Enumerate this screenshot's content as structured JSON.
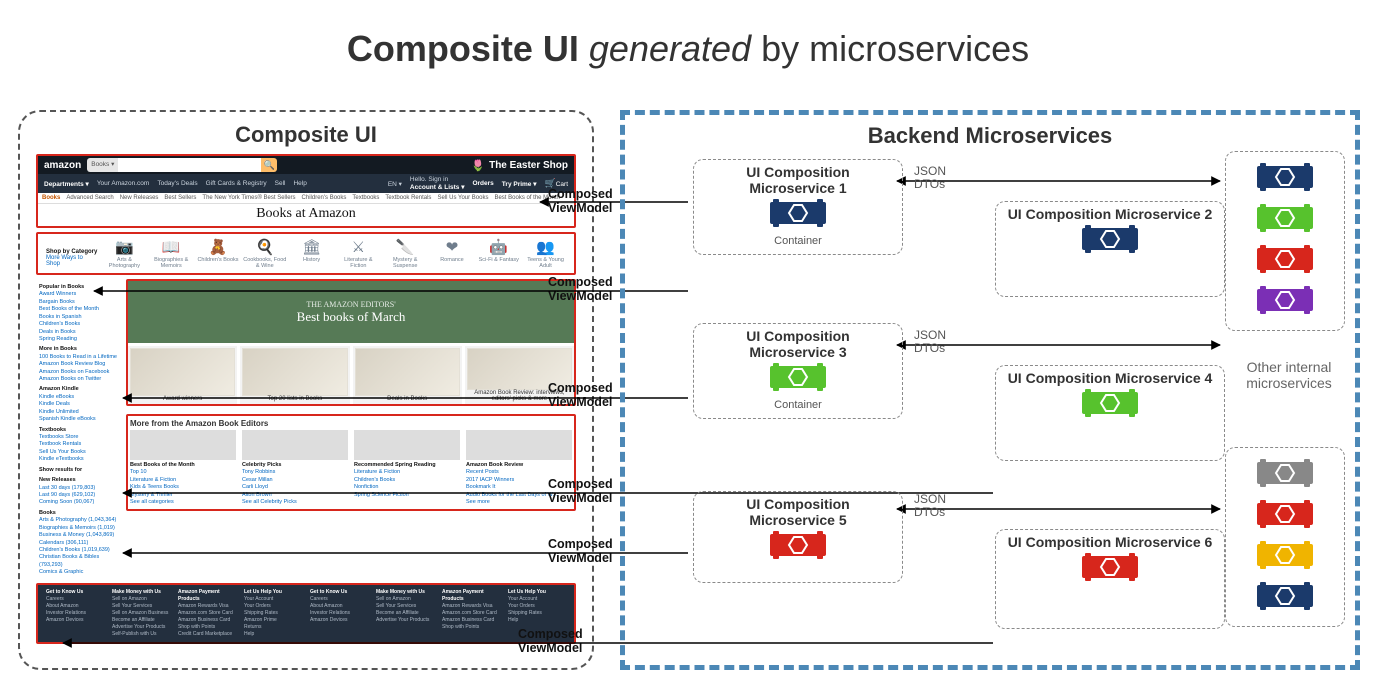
{
  "title": {
    "bold1": "Composite UI",
    "italic": "generated",
    "rest": "by microservices"
  },
  "left": {
    "title": "Composite UI",
    "header": {
      "logo": "amazon",
      "logo_sub": "Try Prime",
      "search_cat": "Books ▾",
      "easter": "The Easter Shop",
      "nav": [
        "Departments ▾",
        "Your Amazon.com",
        "Today's Deals",
        "Gift Cards & Registry",
        "Sell",
        "Help"
      ],
      "acct_hello": "Hello. Sign in",
      "acct_lists": "Account & Lists ▾",
      "orders": "Orders",
      "tryprime": "Try Prime ▾",
      "cart": "Cart",
      "lang": "EN ▾"
    },
    "subnav": [
      "Books",
      "Advanced Search",
      "New Releases",
      "Best Sellers",
      "The New York Times® Best Sellers",
      "Children's Books",
      "Textbooks",
      "Textbook Rentals",
      "Sell Us Your Books",
      "Best Books of the Month"
    ],
    "books_at": "Books at Amazon",
    "shopby_title": "Shop by Category",
    "shopby_more": "More Ways to Shop",
    "categories": [
      {
        "icon": "📷",
        "label": "Arts & Photography"
      },
      {
        "icon": "📖",
        "label": "Biographies & Memoirs"
      },
      {
        "icon": "🧸",
        "label": "Children's Books"
      },
      {
        "icon": "🍳",
        "label": "Cookbooks, Food & Wine"
      },
      {
        "icon": "🏛",
        "label": "History"
      },
      {
        "icon": "⚔",
        "label": "Literature & Fiction"
      },
      {
        "icon": "🔪",
        "label": "Mystery & Suspense"
      },
      {
        "icon": "❤",
        "label": "Romance"
      },
      {
        "icon": "🤖",
        "label": "Sci-Fi & Fantasy"
      },
      {
        "icon": "👥",
        "label": "Teens & Young Adult"
      }
    ],
    "sidebar_groups": [
      {
        "title": "Popular in Books",
        "items": [
          "Award Winners",
          "Bargain Books",
          "Best Books of the Month",
          "Books in Spanish",
          "Children's Books",
          "Deals in Books",
          "Spring Reading"
        ]
      },
      {
        "title": "More in Books",
        "items": [
          "100 Books to Read in a Lifetime",
          "Amazon Book Review Blog",
          "Amazon Books on Facebook",
          "Amazon Books on Twitter"
        ]
      },
      {
        "title": "Amazon Kindle",
        "items": [
          "Kindle eBooks",
          "Kindle Deals",
          "Kindle Unlimited",
          "Spanish Kindle eBooks"
        ]
      },
      {
        "title": "Textbooks",
        "items": [
          "Textbooks Store",
          "Textbook Rentals",
          "Sell Us Your Books",
          "Kindle eTextbooks"
        ]
      },
      {
        "title": "Show results for",
        "items": []
      },
      {
        "title": "New Releases",
        "items": [
          "Last 30 days (179,803)",
          "Last 90 days (629,102)",
          "Coming Soon (90,067)"
        ]
      },
      {
        "title": "Books",
        "items": [
          "Arts & Photography (1,043,364)",
          "Biographies & Memoirs (1,019)",
          "Business & Money (1,043,869)",
          "Calendars (306,111)",
          "Children's Books (1,019,639)",
          "Christian Books & Bibles (793,293)",
          "Comics & Graphic"
        ]
      }
    ],
    "best_small": "THE AMAZON EDITORS'",
    "best_big": "Best books of March",
    "tiles": [
      "Award winners",
      "Top 20 lists in Books",
      "Deals in Books",
      "Amazon Book Review: interviews, editors' picks & more"
    ],
    "editors_head": "More from the Amazon Book Editors",
    "editors": [
      {
        "hd": "Best Books of the Month",
        "items": [
          "Top 10",
          "Literature & Fiction",
          "Kids & Teens Books",
          "Mystery & Thriller",
          "See all categories"
        ]
      },
      {
        "hd": "Celebrity Picks",
        "items": [
          "Tony Robbins",
          "Cesar Millan",
          "Carli Lloyd",
          "Alton Brown",
          "See all Celebrity Picks"
        ]
      },
      {
        "hd": "Recommended Spring Reading",
        "items": [
          "Literature & Fiction",
          "Children's Books",
          "Nonfiction",
          "Spring Science Fiction"
        ]
      },
      {
        "hd": "Amazon Book Review",
        "items": [
          "Recent Posts",
          "2017 IACP Winners",
          "Bookmark It",
          "Audio Books for the Last Days of W...",
          "See more"
        ]
      }
    ],
    "footer_cols": [
      {
        "hd": "Get to Know Us",
        "items": [
          "Careers",
          "About Amazon",
          "Investor Relations",
          "Amazon Devices"
        ]
      },
      {
        "hd": "Make Money with Us",
        "items": [
          "Sell on Amazon",
          "Sell Your Services",
          "Sell on Amazon Business",
          "Become an Affiliate",
          "Advertise Your Products",
          "Self-Publish with Us"
        ]
      },
      {
        "hd": "Amazon Payment Products",
        "items": [
          "Amazon Rewards Visa",
          "Amazon.com Store Card",
          "Amazon Business Card",
          "Shop with Points",
          "Credit Card Marketplace"
        ]
      },
      {
        "hd": "Let Us Help You",
        "items": [
          "Your Account",
          "Your Orders",
          "Shipping Rates",
          "Amazon Prime",
          "Returns",
          "Help"
        ]
      },
      {
        "hd": "Get to Know Us",
        "items": [
          "Careers",
          "About Amazon",
          "Investor Relations",
          "Amazon Devices"
        ]
      },
      {
        "hd": "Make Money with Us",
        "items": [
          "Sell on Amazon",
          "Sell Your Services",
          "Become an Affiliate",
          "Advertise Your Products"
        ]
      },
      {
        "hd": "Amazon Payment Products",
        "items": [
          "Amazon Rewards Visa",
          "Amazon.com Store Card",
          "Amazon Business Card",
          "Shop with Points"
        ]
      },
      {
        "hd": "Let Us Help You",
        "items": [
          "Your Account",
          "Your Orders",
          "Shipping Rates",
          "Help"
        ]
      }
    ]
  },
  "arrows": {
    "label": "Composed ViewModel"
  },
  "right": {
    "title": "Backend Microservices",
    "ms": [
      {
        "name": "UI Composition Microservice 1",
        "sub": "Container",
        "color": "#1b3a6b"
      },
      {
        "name": "UI Composition Microservice 2",
        "sub": "",
        "color": "#1b3a6b"
      },
      {
        "name": "UI Composition Microservice 3",
        "sub": "Container",
        "color": "#57c22d"
      },
      {
        "name": "UI Composition Microservice 4",
        "sub": "",
        "color": "#57c22d"
      },
      {
        "name": "UI Composition Microservice 5",
        "sub": "",
        "color": "#d7261c"
      },
      {
        "name": "UI Composition Microservice 6",
        "sub": "",
        "color": "#d7261c"
      }
    ],
    "dto": "JSON DTOs",
    "other_label": "Other internal microservices",
    "stack1": [
      "#1b3a6b",
      "#57c22d",
      "#d7261c",
      "#7b2fb5"
    ],
    "stack2": [
      "#888888",
      "#d7261c",
      "#f0b400",
      "#1b3a6b"
    ]
  }
}
